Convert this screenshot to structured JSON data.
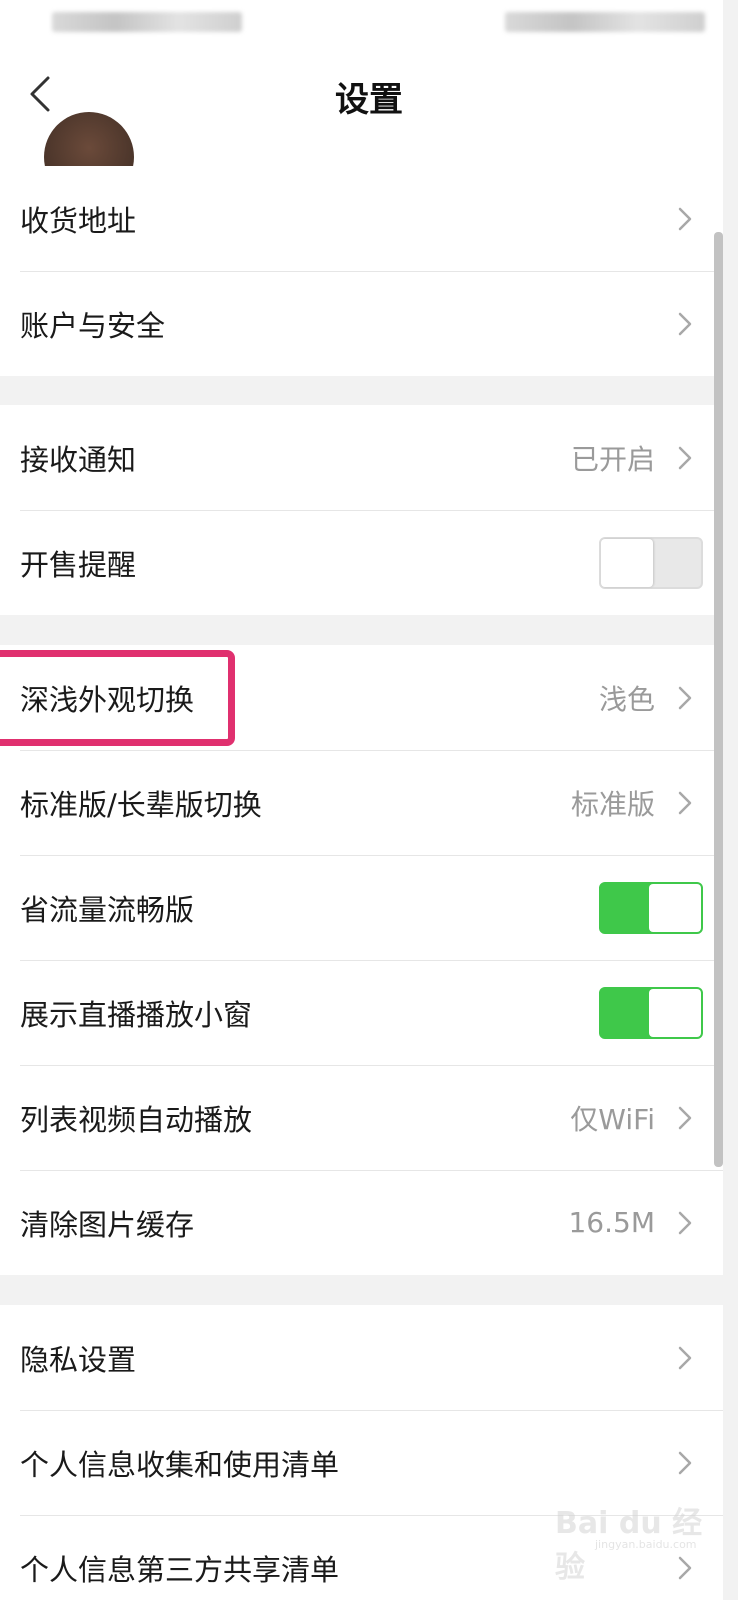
{
  "header": {
    "title": "设置"
  },
  "sections": [
    {
      "items": [
        {
          "label": "收货地址",
          "type": "nav"
        },
        {
          "label": "账户与安全",
          "type": "nav"
        }
      ]
    },
    {
      "items": [
        {
          "label": "接收通知",
          "type": "nav",
          "value": "已开启"
        },
        {
          "label": "开售提醒",
          "type": "toggle",
          "on": false
        }
      ]
    },
    {
      "items": [
        {
          "label": "深浅外观切换",
          "type": "nav",
          "value": "浅色"
        },
        {
          "label": "标准版/长辈版切换",
          "type": "nav",
          "value": "标准版"
        },
        {
          "label": "省流量流畅版",
          "type": "toggle",
          "on": true
        },
        {
          "label": "展示直播播放小窗",
          "type": "toggle",
          "on": true
        },
        {
          "label": "列表视频自动播放",
          "type": "nav",
          "value": "仅WiFi"
        },
        {
          "label": "清除图片缓存",
          "type": "nav",
          "value": "16.5M"
        }
      ]
    },
    {
      "items": [
        {
          "label": "隐私设置",
          "type": "nav"
        },
        {
          "label": "个人信息收集和使用清单",
          "type": "nav"
        },
        {
          "label": "个人信息第三方共享清单",
          "type": "nav"
        }
      ]
    }
  ],
  "colors": {
    "toggle_on": "#3fc84a",
    "highlight": "#e0306f"
  },
  "watermark": {
    "text": "Bai du 经验",
    "url": "jingyan.baidu.com"
  }
}
